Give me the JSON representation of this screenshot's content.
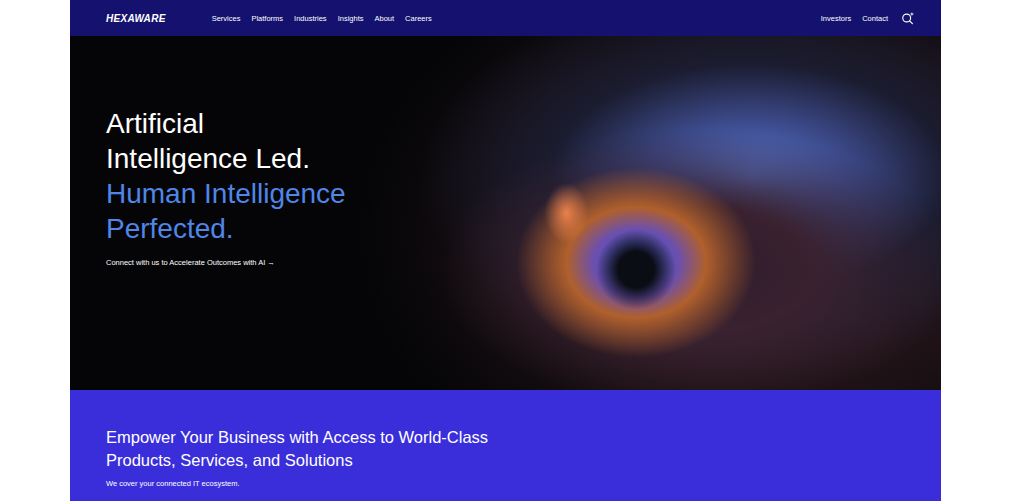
{
  "logo": "HEXAWARE",
  "nav": {
    "items": [
      "Services",
      "Platforms",
      "Industries",
      "Insights",
      "About",
      "Careers"
    ],
    "right": [
      "Investors",
      "Contact"
    ]
  },
  "hero": {
    "title_lines": [
      "Artificial",
      "Intelligence Led."
    ],
    "accent_lines": [
      "Human Intelligence",
      "Perfected."
    ],
    "cta": "Connect with us to Accelerate Outcomes with AI →"
  },
  "banner": {
    "heading_lines": [
      "Empower Your Business with Access to World-Class",
      "Products, Services, and Solutions"
    ],
    "subtext": "We cover your connected IT ecosystem."
  }
}
